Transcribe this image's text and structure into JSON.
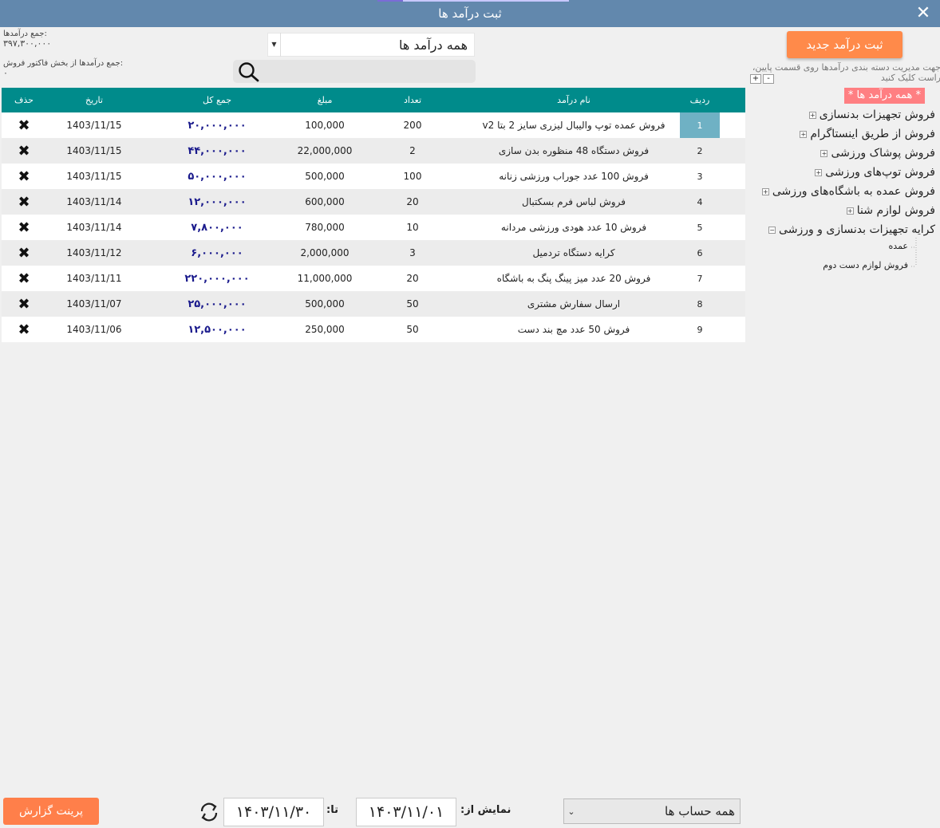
{
  "window": {
    "title": "ثبت درآمد ها"
  },
  "summary": {
    "total_label": "جمع درآمدها:",
    "total_value": "۳۹۷,۳۰۰,۰۰۰",
    "invoice_label": "جمع درآمدها از بخش فاکتور فروش:",
    "invoice_value": "۰"
  },
  "filter": {
    "selected": "همه درآمد ها",
    "search_placeholder": ""
  },
  "table": {
    "columns": [
      "ردیف",
      "نام درآمد",
      "تعداد",
      "مبلغ",
      "جمع کل",
      "تاریخ",
      "حذف"
    ],
    "rows": [
      {
        "idx": "1",
        "name": "فروش عمده توپ والیبال لیزری سایز 2 بتا v2",
        "qty": "200",
        "amount": "100,000",
        "total": "۲۰,۰۰۰,۰۰۰",
        "date": "1403/11/15"
      },
      {
        "idx": "2",
        "name": "فروش دستگاه 48 منظوره بدن سازی",
        "qty": "2",
        "amount": "22,000,000",
        "total": "۴۴,۰۰۰,۰۰۰",
        "date": "1403/11/15"
      },
      {
        "idx": "3",
        "name": "فروش 100 عدد جوراب ورزشی زنانه",
        "qty": "100",
        "amount": "500,000",
        "total": "۵۰,۰۰۰,۰۰۰",
        "date": "1403/11/15"
      },
      {
        "idx": "4",
        "name": "فروش لباس فرم بسکتبال",
        "qty": "20",
        "amount": "600,000",
        "total": "۱۲,۰۰۰,۰۰۰",
        "date": "1403/11/14"
      },
      {
        "idx": "5",
        "name": "فروش 10 عدد هودی ورزشی مردانه",
        "qty": "10",
        "amount": "780,000",
        "total": "۷,۸۰۰,۰۰۰",
        "date": "1403/11/14"
      },
      {
        "idx": "6",
        "name": "کرایه دستگاه تردمیل",
        "qty": "3",
        "amount": "2,000,000",
        "total": "۶,۰۰۰,۰۰۰",
        "date": "1403/11/12"
      },
      {
        "idx": "7",
        "name": "فروش 20 عدد میز پینگ پنگ به باشگاه",
        "qty": "20",
        "amount": "11,000,000",
        "total": "۲۲۰,۰۰۰,۰۰۰",
        "date": "1403/11/11"
      },
      {
        "idx": "8",
        "name": "ارسال سفارش مشتری",
        "qty": "50",
        "amount": "500,000",
        "total": "۲۵,۰۰۰,۰۰۰",
        "date": "1403/11/07"
      },
      {
        "idx": "9",
        "name": "فروش 50 عدد مچ بند دست",
        "qty": "50",
        "amount": "250,000",
        "total": "۱۲,۵۰۰,۰۰۰",
        "date": "1403/11/06"
      }
    ]
  },
  "sidebar": {
    "new_button": "ثبت درآمد جدید",
    "hint": "جهت مدیریت دسته بندی درآمدها روی قسمت پایین، راست کلیک کنید",
    "plus": "+",
    "minus": "-",
    "root": "* همه درآمد ها *",
    "categories": [
      "فروش تجهیزات بدنسازی",
      "فروش از طریق اینستاگرام",
      "فروش پوشاک ورزشی",
      "فروش توپ‌های ورزشی",
      "فروش عمده به باشگاه‌های ورزشی",
      "فروش لوازم شنا",
      "کرایه تجهیزات بدنسازی و ورزشی"
    ],
    "subcategories": [
      "عمده",
      "فروش لوازم دست دوم"
    ]
  },
  "footer": {
    "print_button": "پرینت گزارش",
    "to_label": "تا:",
    "to_date": "۱۴۰۳/۱۱/۳۰",
    "from_label": "نمایش از:",
    "from_date": "۱۴۰۳/۱۱/۰۱",
    "account_selected": "همه حساب ها"
  },
  "colors": {
    "titlebar": "#6288ad",
    "grid_header": "#008b8b",
    "button_orange": "#ff8a4a",
    "tree_root_bg": "#ff7f82",
    "total_text": "#1a1a8c"
  }
}
